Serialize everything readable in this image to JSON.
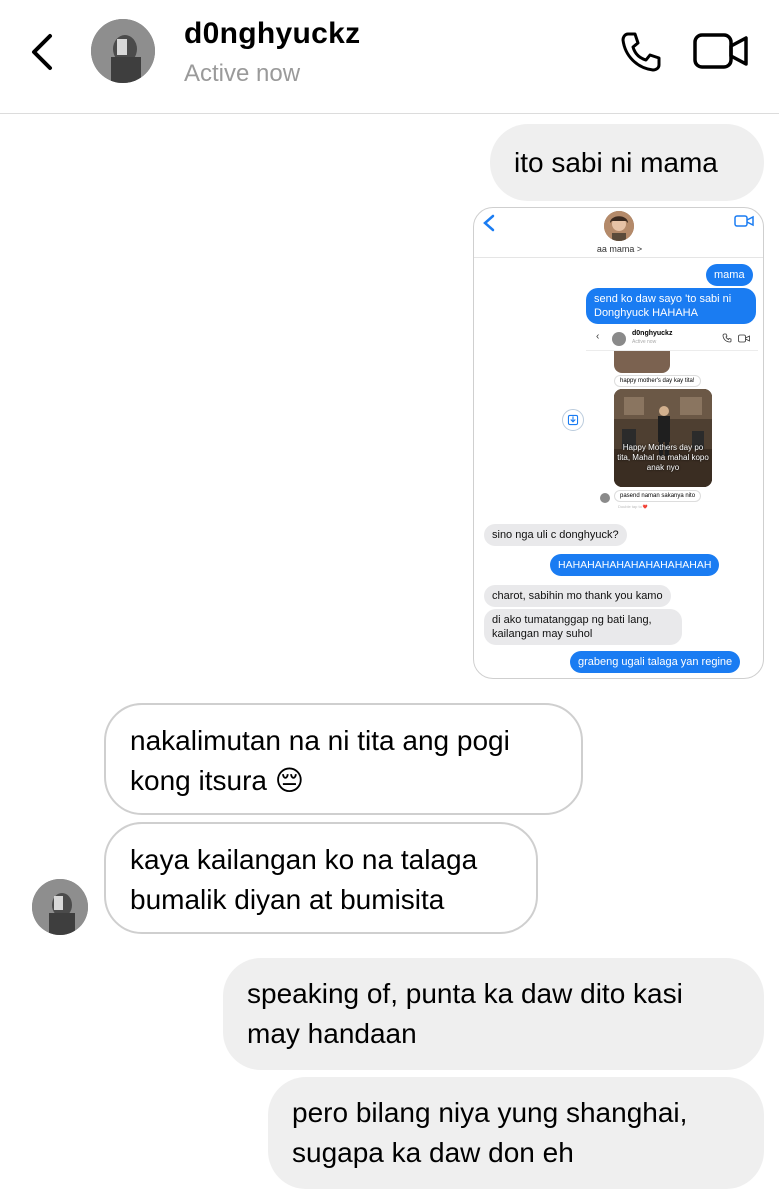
{
  "header": {
    "name": "d0nghyuckz",
    "status": "Active now"
  },
  "messages": [
    {
      "from": "me",
      "text": "ito sabi ni mama"
    },
    {
      "from": "them",
      "text": "nakalimutan na ni tita ang pogi kong itsura 😔"
    },
    {
      "from": "them",
      "text": "kaya kailangan ko na talaga bumalik diyan at bumisita"
    },
    {
      "from": "me",
      "text": "speaking of, punta ka daw dito kasi may handaan"
    },
    {
      "from": "me",
      "text": "pero bilang niya yung shanghai, sugapa ka daw don eh"
    }
  ],
  "embedded": {
    "contact": "aa mama >",
    "messages": [
      "mama",
      "send ko daw sayo 'to sabi ni Donghyuck HAHAHA",
      "sino nga uli c donghyuck?",
      "HAHAHAHAHAHAHAHAHAHAH",
      "charot, sabihin mo thank you kamo",
      "di ako tumatanggap ng bati lang, kailangan may suhol",
      "grabeng ugali talaga yan regine"
    ],
    "inner": {
      "name": "d0nghyuckz",
      "status": "Active now",
      "msg1": "happy mother's day kay tita!",
      "caption": "Happy Mothers day po tita, Mahal na mahal kopo anak nyo",
      "msg2": "pasend naman sakanya nito",
      "reaction": "Double tap to ❤️"
    }
  },
  "colors": {
    "blue_bubble": "#1a7cf2",
    "out_bubble": "#efefef",
    "in_border": "#cfcfcf"
  }
}
